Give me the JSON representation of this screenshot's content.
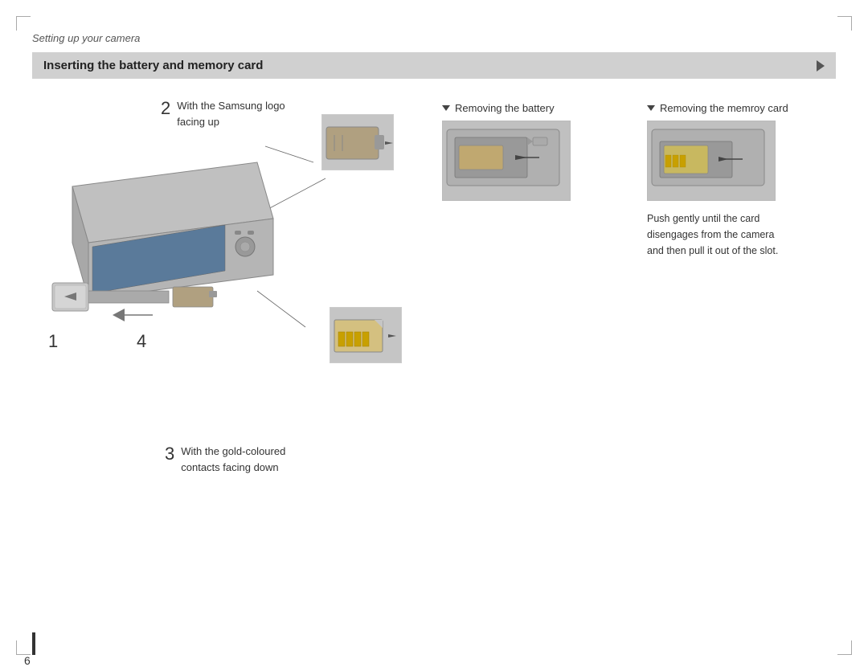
{
  "page": {
    "section_title": "Setting up your camera",
    "header": {
      "title": "Inserting the battery and memory card"
    },
    "steps": [
      {
        "number": "1",
        "text": ""
      },
      {
        "number": "2",
        "text": "With the Samsung logo\nfacing up"
      },
      {
        "number": "3",
        "text": "With the gold-coloured\ncontacts facing down"
      },
      {
        "number": "4",
        "text": ""
      }
    ],
    "removing": {
      "battery": {
        "title": "Removing the battery",
        "triangle": "▼"
      },
      "memory_card": {
        "title": "Removing the memroy card",
        "triangle": "▼",
        "description": "Push gently until the card\ndisengages from the camera\nand then pull it out of the slot."
      }
    },
    "page_number": "6"
  }
}
